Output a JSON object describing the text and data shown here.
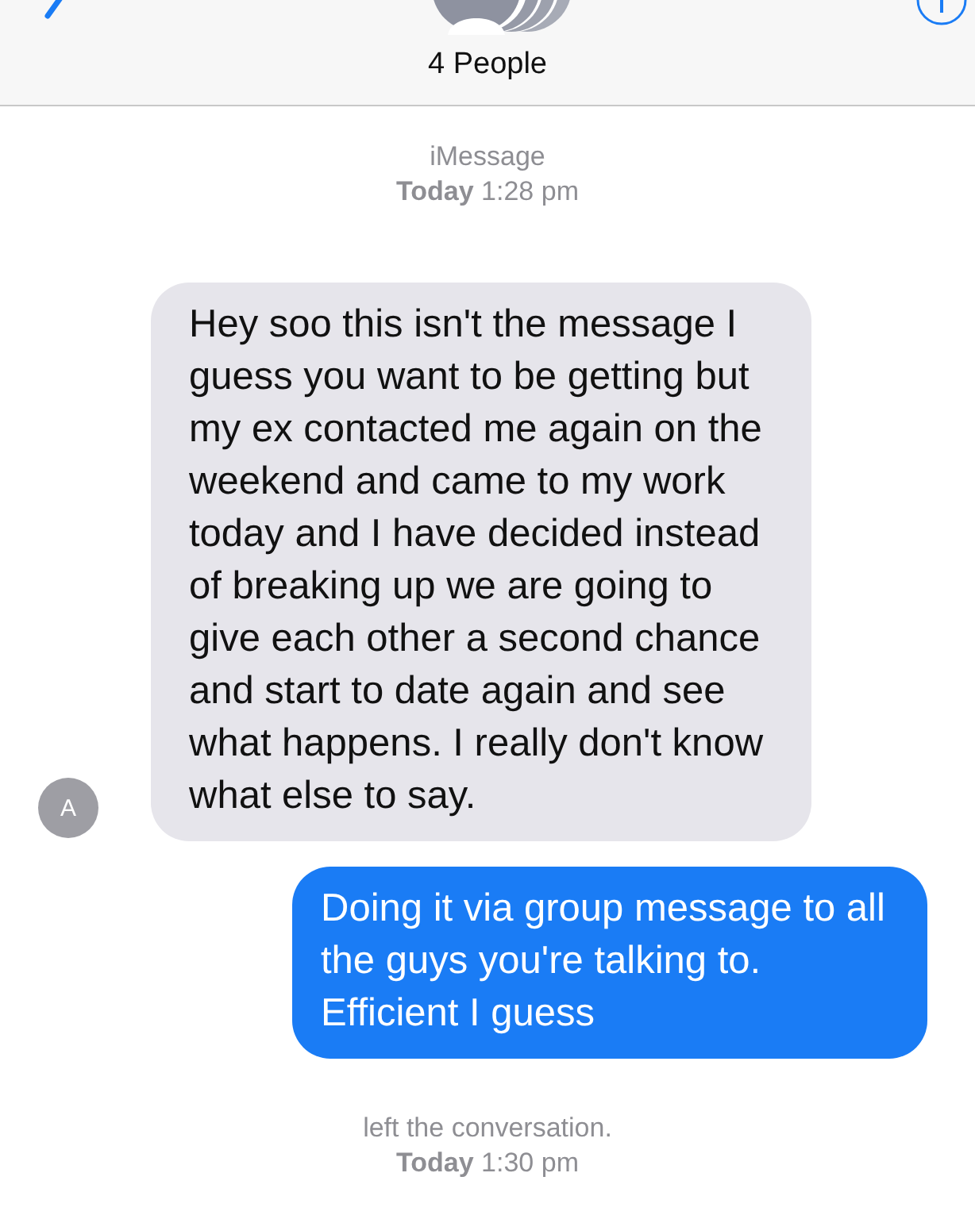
{
  "header": {
    "title": "4 People"
  },
  "messages": [
    {
      "kind": "status",
      "lines": [
        "iMessage",
        "**Today** 1:28 pm"
      ]
    },
    {
      "kind": "received",
      "sender_initial": "A",
      "text": "Hey soo this isn't the message I guess you want to be getting but my ex contacted me again on the weekend and came to my work today and I have decided instead of breaking up we are going to give each other a second chance and start to date again and see what happens. I really don't know what else to say."
    },
    {
      "kind": "sent",
      "text": "Doing it via group message to all the guys you're talking to. Efficient I guess"
    },
    {
      "kind": "status",
      "lines": [
        "left the conversation.",
        "**Today** 1:30 pm"
      ]
    }
  ]
}
